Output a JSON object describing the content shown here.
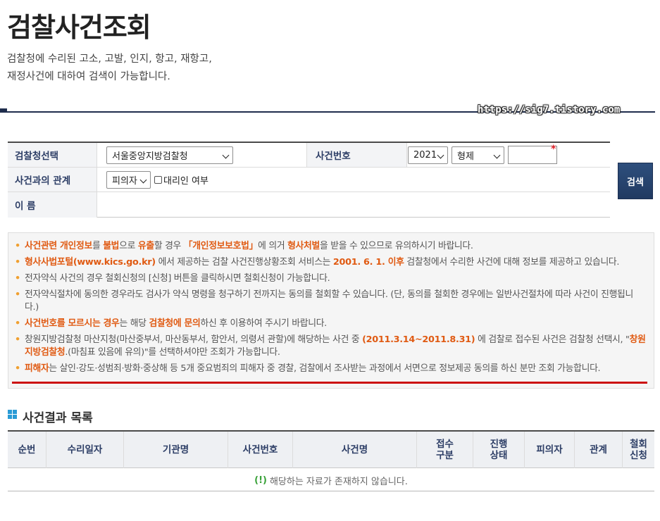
{
  "page": {
    "title": "검찰사건조회",
    "intro_line1": "검찰청에 수리된 고소, 고발, 인지, 항고, 재항고,",
    "intro_line2": "재정사건에 대하여 검색이 가능합니다.",
    "watermark": "https://sig7.tistory.com"
  },
  "form": {
    "prosecutor_label": "검찰청선택",
    "prosecutor_value": "서울중앙지방검찰청",
    "case_no_label": "사건번호",
    "year_value": "2021",
    "case_type_value": "형제",
    "case_no_value": "",
    "required_mark": "*",
    "relation_label": "사건과의 관계",
    "relation_value": "피의자",
    "proxy_label": "대리인 여부",
    "name_label": "이 름",
    "search_button": "검색"
  },
  "notices": [
    {
      "parts": [
        {
          "t": "사건관련 개인정보",
          "h": true
        },
        {
          "t": "를 ",
          "h": false
        },
        {
          "t": "불법",
          "h": true
        },
        {
          "t": "으로 ",
          "h": false
        },
        {
          "t": "유출",
          "h": true
        },
        {
          "t": "할 경우 ",
          "h": false
        },
        {
          "t": "「개인정보보호법」",
          "h": true
        },
        {
          "t": "에 의거 ",
          "h": false
        },
        {
          "t": "형사처벌",
          "h": true
        },
        {
          "t": "을 받을 수 있으므로 유의하시기 바랍니다.",
          "h": false
        }
      ]
    },
    {
      "parts": [
        {
          "t": "형사사법포털(www.kics.go.kr)",
          "h": true
        },
        {
          "t": " 에서 제공하는 검찰 사건진행상황조회 서비스는 ",
          "h": false
        },
        {
          "t": "2001. 6. 1. 이후",
          "h": true
        },
        {
          "t": " 검찰청에서 수리한 사건에 대해 정보를 제공하고 있습니다.",
          "h": false
        }
      ]
    },
    {
      "parts": [
        {
          "t": "전자약식 사건의 경우 철회신청의 [신청] 버튼을 클릭하시면 철회신청이 가능합니다.",
          "h": false
        }
      ]
    },
    {
      "parts": [
        {
          "t": "전자약식절차에 동의한 경우라도 검사가 약식 명령을 청구하기 전까지는 동의를 철회할 수 있습니다. (단, 동의를 철회한 경우에는 일반사건절차에 따라 사건이 진행됩니다.)",
          "h": false
        }
      ]
    },
    {
      "parts": [
        {
          "t": "사건번호를 모르시는 경우",
          "h": true
        },
        {
          "t": "는 해당 ",
          "h": false
        },
        {
          "t": "검찰청에 문의",
          "h": true
        },
        {
          "t": "하신 후 이용하여 주시기 바랍니다.",
          "h": false
        }
      ]
    },
    {
      "parts": [
        {
          "t": "창원지방검찰청 마산지청(마산중부서, 마산동부서, 함안서, 의령서 관할)에 해당하는 사건 중 ",
          "h": false
        },
        {
          "t": "(2011.3.14~2011.8.31)",
          "h": true
        },
        {
          "t": " 에 검찰로 접수된 사건은 검찰청 선택시, \"",
          "h": false
        },
        {
          "t": "창원지방검찰청",
          "h": true
        },
        {
          "t": ".(마침표 있음에 유의)\"를 선택하셔야만 조회가 가능합니다.",
          "h": false
        }
      ]
    },
    {
      "parts": [
        {
          "t": "피해자",
          "h": true
        },
        {
          "t": "는 살인·강도·성범죄·방화·중상해 등 5개 중요범죄의 피해자 중 경찰, 검찰에서 조사받는 과정에서 서면으로 정보제공 동의를 하신 분만 조회 가능합니다.",
          "h": false
        }
      ]
    }
  ],
  "results": {
    "title": "사건결과 목록",
    "columns": [
      "순번",
      "수리일자",
      "기관명",
      "사건번호",
      "사건명",
      "접수\n구분",
      "진행\n상태",
      "피의자",
      "관계",
      "철회\n신청"
    ],
    "empty_icon": "(!)",
    "empty_message": "해당하는 자료가 존재하지 않습니다."
  },
  "colors": {
    "highlight": "#e05a12",
    "header_text": "#2d3e66",
    "button": "#213a61",
    "underline": "#cc1111"
  }
}
